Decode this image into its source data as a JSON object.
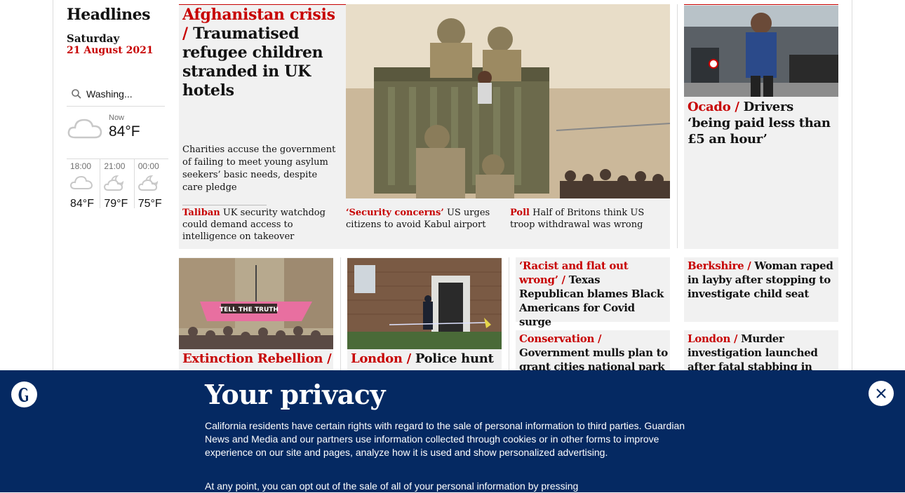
{
  "sidebar": {
    "title": "Headlines",
    "day": "Saturday",
    "date": "21 August 2021",
    "search_value": "Washing...",
    "weather_now_label": "Now",
    "weather_now_temp": "84°F",
    "forecast": [
      {
        "time": "18:00",
        "temp": "84°F"
      },
      {
        "time": "21:00",
        "temp": "79°F"
      },
      {
        "time": "00:00",
        "temp": "75°F"
      }
    ]
  },
  "lead": {
    "kicker": "Afghanistan crisis /",
    "headline": "Traumatised refugee children stranded in UK hotels",
    "standfirst": "Charities accuse the government of failing to meet young asylum seekers’ basic needs, despite care pledge",
    "subs": [
      {
        "kicker": "Taliban",
        "text": "UK security watchdog could demand access to intelligence on takeover"
      },
      {
        "kicker": "‘Security concerns’",
        "text": "US urges citizens to avoid Kabul airport"
      },
      {
        "kicker": "Poll",
        "text": "Half of Britons think US troop withdrawal was wrong"
      }
    ]
  },
  "ocado": {
    "kicker": "Ocado /",
    "headline": "Drivers ‘being paid less than £5 an hour’"
  },
  "row2": [
    {
      "kicker": "Extinction Rebellion /",
      "headline": ""
    },
    {
      "kicker": "London /",
      "headline": "Police hunt"
    },
    {
      "kicker": "‘Racist and flat out wrong’ /",
      "headline": "Texas Republican blames Black Americans for Covid surge"
    },
    {
      "kicker": "Berkshire /",
      "headline": "Woman raped in layby after stopping to investigate child seat"
    },
    {
      "kicker": "Conservation /",
      "headline": "Government mulls plan to grant cities national park"
    },
    {
      "kicker": "London /",
      "headline": "Murder investigation launched after fatal stabbing in"
    }
  ],
  "privacy": {
    "title": "Your privacy",
    "para1": "California residents have certain rights with regard to the sale of personal information to third parties. Guardian News and Media and our partners use information collected through cookies or in other forms to improve experience on our site and pages, analyze how it is used and show personalized advertising.",
    "para2": "At any point, you can opt out of the sale of all of your personal information by pressing"
  },
  "colors": {
    "accent": "#c70000",
    "privacy_bg": "#052962",
    "card_bg": "#f1f1f1"
  },
  "icons": [
    "search-icon",
    "cloud-icon",
    "moon-cloud-icon",
    "guardian-logo-icon",
    "close-icon"
  ]
}
